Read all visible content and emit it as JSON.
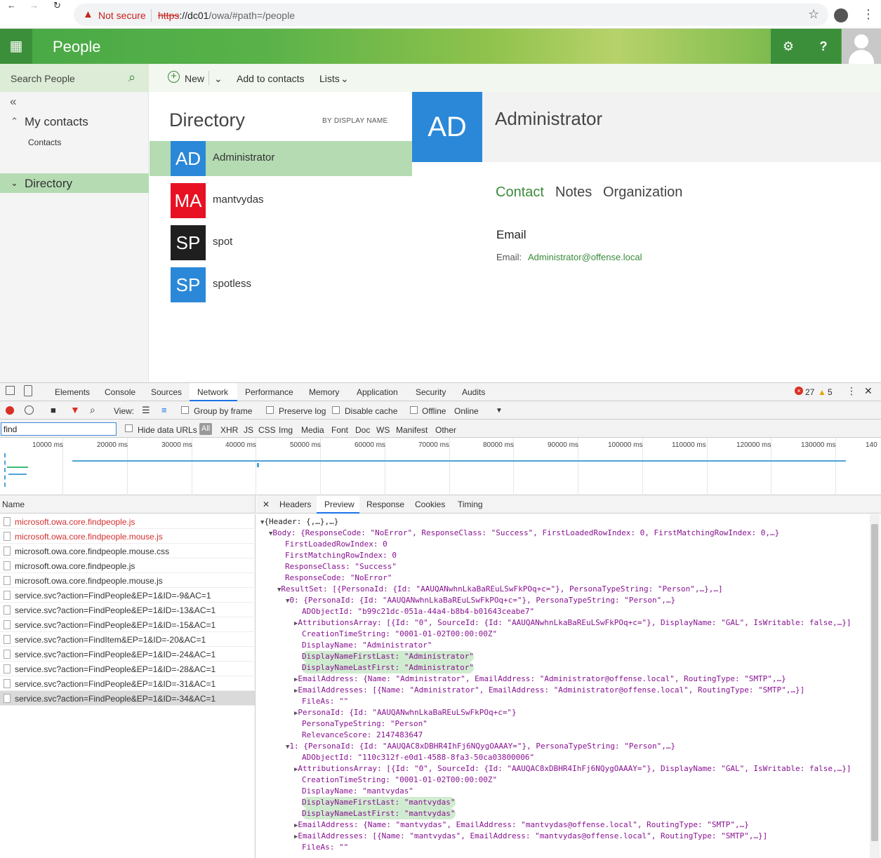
{
  "browser": {
    "not_secure": "Not secure",
    "url_scheme": "https",
    "url_host": "://dc01",
    "url_path": "/owa/#path=/people"
  },
  "app": {
    "title": "People",
    "settings_icon": "gear-icon",
    "help_label": "?"
  },
  "search": {
    "placeholder": "Search People"
  },
  "toolbar": {
    "new_label": "New",
    "add_label": "Add to contacts",
    "lists_label": "Lists"
  },
  "nav": {
    "collapse": "«",
    "my_contacts": "My contacts",
    "contacts": "Contacts",
    "directory": "Directory"
  },
  "directory": {
    "title": "Directory",
    "sort": "BY DISPLAY NAME",
    "people": [
      {
        "initials": "AD",
        "name": "Administrator",
        "color": "#2b88d8"
      },
      {
        "initials": "MA",
        "name": "mantvydas",
        "color": "#e81123"
      },
      {
        "initials": "SP",
        "name": "spot",
        "color": "#1f1f1f"
      },
      {
        "initials": "SP",
        "name": "spotless",
        "color": "#2b88d8"
      }
    ]
  },
  "detail": {
    "initials": "AD",
    "name": "Administrator",
    "tabs": [
      "Contact",
      "Notes",
      "Organization"
    ],
    "email_heading": "Email",
    "email_label": "Email:",
    "email_value": "Administrator@offense.local"
  },
  "devtools": {
    "tabs": [
      "Elements",
      "Console",
      "Sources",
      "Network",
      "Performance",
      "Memory",
      "Application",
      "Security",
      "Audits"
    ],
    "errors": "27",
    "warnings": "5",
    "bar2": {
      "view": "View:",
      "group": "Group by frame",
      "preserve": "Preserve log",
      "disable": "Disable cache",
      "offline": "Offline",
      "online": "Online"
    },
    "filter": "find",
    "hide_data": "Hide data URLs",
    "all": "All",
    "types": [
      "XHR",
      "JS",
      "CSS",
      "Img",
      "Media",
      "Font",
      "Doc",
      "WS",
      "Manifest",
      "Other"
    ],
    "timeline": [
      "10000 ms",
      "20000 ms",
      "30000 ms",
      "40000 ms",
      "50000 ms",
      "60000 ms",
      "70000 ms",
      "80000 ms",
      "90000 ms",
      "100000 ms",
      "110000 ms",
      "120000 ms",
      "130000 ms",
      "140"
    ],
    "name_header": "Name",
    "requests": [
      "microsoft.owa.core.findpeople.js",
      "microsoft.owa.core.findpeople.mouse.js",
      "microsoft.owa.core.findpeople.mouse.css",
      "microsoft.owa.core.findpeople.js",
      "microsoft.owa.core.findpeople.mouse.js",
      "service.svc?action=FindPeople&EP=1&ID=-9&AC=1",
      "service.svc?action=FindPeople&EP=1&ID=-13&AC=1",
      "service.svc?action=FindPeople&EP=1&ID=-15&AC=1",
      "service.svc?action=FindItem&EP=1&ID=-20&AC=1",
      "service.svc?action=FindPeople&EP=1&ID=-24&AC=1",
      "service.svc?action=FindPeople&EP=1&ID=-28&AC=1",
      "service.svc?action=FindPeople&EP=1&ID=-31&AC=1",
      "service.svc?action=FindPeople&EP=1&ID=-34&AC=1"
    ],
    "detail_tabs": [
      "Headers",
      "Preview",
      "Response",
      "Cookies",
      "Timing"
    ],
    "preview": [
      "{Header: {,…},…}",
      "Body: {ResponseCode: \"NoError\", ResponseClass: \"Success\", FirstLoadedRowIndex: 0, FirstMatchingRowIndex: 0,…}",
      "FirstLoadedRowIndex: 0",
      "FirstMatchingRowIndex: 0",
      "ResponseClass: \"Success\"",
      "ResponseCode: \"NoError\"",
      "ResultSet: [{PersonaId: {Id: \"AAUQANwhnLkaBaREuLSwFkPOq+c=\"}, PersonaTypeString: \"Person\",…},…]",
      "0: {PersonaId: {Id: \"AAUQANwhnLkaBaREuLSwFkPOq+c=\"}, PersonaTypeString: \"Person\",…}",
      "ADObjectId: \"b99c21dc-051a-44a4-b8b4-b01643ceabe7\"",
      "AttributionsArray: [{Id: \"0\", SourceId: {Id: \"AAUQANwhnLkaBaREuLSwFkPOq+c=\"}, DisplayName: \"GAL\", IsWritable: false,…}]",
      "CreationTimeString: \"0001-01-02T00:00:00Z\"",
      "DisplayName: \"Administrator\"",
      "DisplayNameFirstLast: \"Administrator\"",
      "DisplayNameLastFirst: \"Administrator\"",
      "EmailAddress: {Name: \"Administrator\", EmailAddress: \"Administrator@offense.local\", RoutingType: \"SMTP\",…}",
      "EmailAddresses: [{Name: \"Administrator\", EmailAddress: \"Administrator@offense.local\", RoutingType: \"SMTP\",…}]",
      "FileAs: \"\"",
      "PersonaId: {Id: \"AAUQANwhnLkaBaREuLSwFkPOq+c=\"}",
      "PersonaTypeString: \"Person\"",
      "RelevanceScore: 2147483647",
      "1: {PersonaId: {Id: \"AAUQAC8xDBHR4IhFj6NQygOAAAY=\"}, PersonaTypeString: \"Person\",…}",
      "ADObjectId: \"110c312f-e0d1-4588-8fa3-50ca03800006\"",
      "AttributionsArray: [{Id: \"0\", SourceId: {Id: \"AAUQAC8xDBHR4IhFj6NQygOAAAY=\"}, DisplayName: \"GAL\", IsWritable: false,…}]",
      "CreationTimeString: \"0001-01-02T00:00:00Z\"",
      "DisplayName: \"mantvydas\"",
      "DisplayNameFirstLast: \"mantvydas\"",
      "DisplayNameLastFirst: \"mantvydas\"",
      "EmailAddress: {Name: \"mantvydas\", EmailAddress: \"mantvydas@offense.local\", RoutingType: \"SMTP\",…}",
      "EmailAddresses: [{Name: \"mantvydas\", EmailAddress: \"mantvydas@offense.local\", RoutingType: \"SMTP\",…}]",
      "FileAs: \"\""
    ]
  }
}
